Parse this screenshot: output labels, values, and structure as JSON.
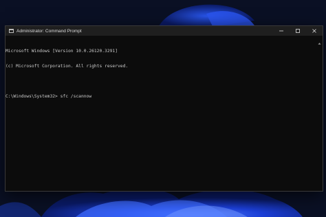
{
  "window": {
    "title": "Administrator: Command Prompt"
  },
  "console": {
    "lines": [
      "Microsoft Windows [Version 10.0.26120.3291]",
      "(c) Microsoft Corporation. All rights reserved.",
      "",
      "C:\\Windows\\System32> sfc /scannow"
    ]
  },
  "icons": {
    "app": "terminal-icon",
    "minimize": "minimize-icon",
    "maximize": "maximize-icon",
    "close": "close-icon",
    "scroll": "scroll-up-icon"
  },
  "colors": {
    "console_bg": "#0c0c0c",
    "console_text": "#cccccc",
    "titlebar_bg": "#1f1f1f",
    "wallpaper_bg": "#0a1024",
    "wallpaper_accent": "#1f49e0"
  }
}
